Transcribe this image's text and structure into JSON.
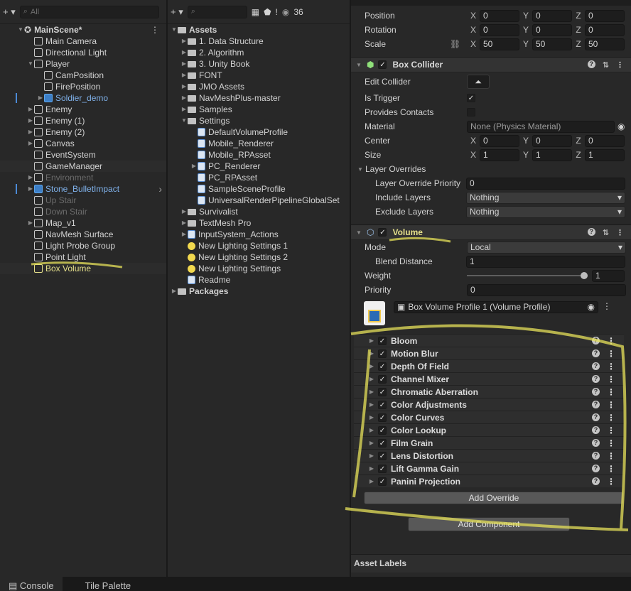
{
  "hierarchy": {
    "search_placeholder": "All",
    "scene": "MainScene*",
    "items": [
      {
        "label": "Main Camera",
        "indent": 1
      },
      {
        "label": "Directional Light",
        "indent": 1
      },
      {
        "label": "Player",
        "indent": 1
      },
      {
        "label": "CamPosition",
        "indent": 2
      },
      {
        "label": "FirePosition",
        "indent": 2
      },
      {
        "label": "Soldier_demo",
        "indent": 2
      },
      {
        "label": "Enemy",
        "indent": 1
      },
      {
        "label": "Enemy (1)",
        "indent": 1
      },
      {
        "label": "Enemy (2)",
        "indent": 1
      },
      {
        "label": "Canvas",
        "indent": 1
      },
      {
        "label": "EventSystem",
        "indent": 1
      },
      {
        "label": "GameManager",
        "indent": 1
      },
      {
        "label": "Environment",
        "indent": 1
      },
      {
        "label": "Stone_BulletImpact",
        "indent": 1
      },
      {
        "label": "Up Stair",
        "indent": 1
      },
      {
        "label": "Down Stair",
        "indent": 1
      },
      {
        "label": "Map_v1",
        "indent": 1
      },
      {
        "label": "NavMesh Surface",
        "indent": 1
      },
      {
        "label": "Light Probe Group",
        "indent": 1
      },
      {
        "label": "Point Light",
        "indent": 1
      },
      {
        "label": "Box Volume",
        "indent": 1
      }
    ]
  },
  "project": {
    "badge_count": "36",
    "root": "Assets",
    "items": [
      {
        "label": "1. Data Structure"
      },
      {
        "label": "2. Algorithm"
      },
      {
        "label": "3. Unity Book"
      },
      {
        "label": "FONT"
      },
      {
        "label": "JMO Assets"
      },
      {
        "label": "NavMeshPlus-master"
      },
      {
        "label": "Samples"
      },
      {
        "label": "Settings"
      },
      {
        "label": "DefaultVolumeProfile"
      },
      {
        "label": "Mobile_Renderer"
      },
      {
        "label": "Mobile_RPAsset"
      },
      {
        "label": "PC_Renderer"
      },
      {
        "label": "PC_RPAsset"
      },
      {
        "label": "SampleSceneProfile"
      },
      {
        "label": "UniversalRenderPipelineGlobalSet"
      },
      {
        "label": "Survivalist"
      },
      {
        "label": "TextMesh Pro"
      },
      {
        "label": "InputSystem_Actions"
      },
      {
        "label": "New Lighting Settings 1"
      },
      {
        "label": "New Lighting Settings 2"
      },
      {
        "label": "New Lighting Settings"
      },
      {
        "label": "Readme"
      }
    ],
    "packages": "Packages"
  },
  "inspector": {
    "transform": {
      "position_label": "Position",
      "position": [
        "0",
        "0",
        "0"
      ],
      "rotation_label": "Rotation",
      "rotation": [
        "0",
        "0",
        "0"
      ],
      "scale_label": "Scale",
      "scale": [
        "50",
        "50",
        "50"
      ]
    },
    "axes": [
      "X",
      "Y",
      "Z"
    ],
    "box_collider": {
      "title": "Box Collider",
      "edit_collider": "Edit Collider",
      "is_trigger": "Is Trigger",
      "provides_contacts": "Provides Contacts",
      "material": "Material",
      "material_value": "None (Physics Material)",
      "center": "Center",
      "center_values": [
        "0",
        "0",
        "0"
      ],
      "size": "Size",
      "size_values": [
        "1",
        "1",
        "1"
      ],
      "layer_overrides": "Layer Overrides",
      "layer_override_priority": "Layer Override Priority",
      "layer_override_priority_value": "0",
      "include_layers": "Include Layers",
      "include_value": "Nothing",
      "exclude_layers": "Exclude Layers",
      "exclude_value": "Nothing"
    },
    "volume": {
      "title": "Volume",
      "mode": "Mode",
      "mode_value": "Local",
      "blend_distance": "Blend Distance",
      "blend_value": "1",
      "weight": "Weight",
      "weight_value": "1",
      "priority": "Priority",
      "priority_value": "0",
      "profile": "Box Volume Profile 1 (Volume Profile)",
      "overrides": [
        "Bloom",
        "Motion Blur",
        "Depth Of Field",
        "Channel Mixer",
        "Chromatic Aberration",
        "Color Adjustments",
        "Color Curves",
        "Color Lookup",
        "Film Grain",
        "Lens Distortion",
        "Lift Gamma Gain",
        "Panini Projection"
      ],
      "add_override": "Add Override"
    },
    "add_component": "Add Component",
    "asset_labels": "Asset Labels"
  },
  "tabs": {
    "console": "Console",
    "tile_palette": "Tile Palette"
  },
  "colors": {
    "highlight": "#e5e08a",
    "blue_prefab": "#7fb1ea"
  }
}
